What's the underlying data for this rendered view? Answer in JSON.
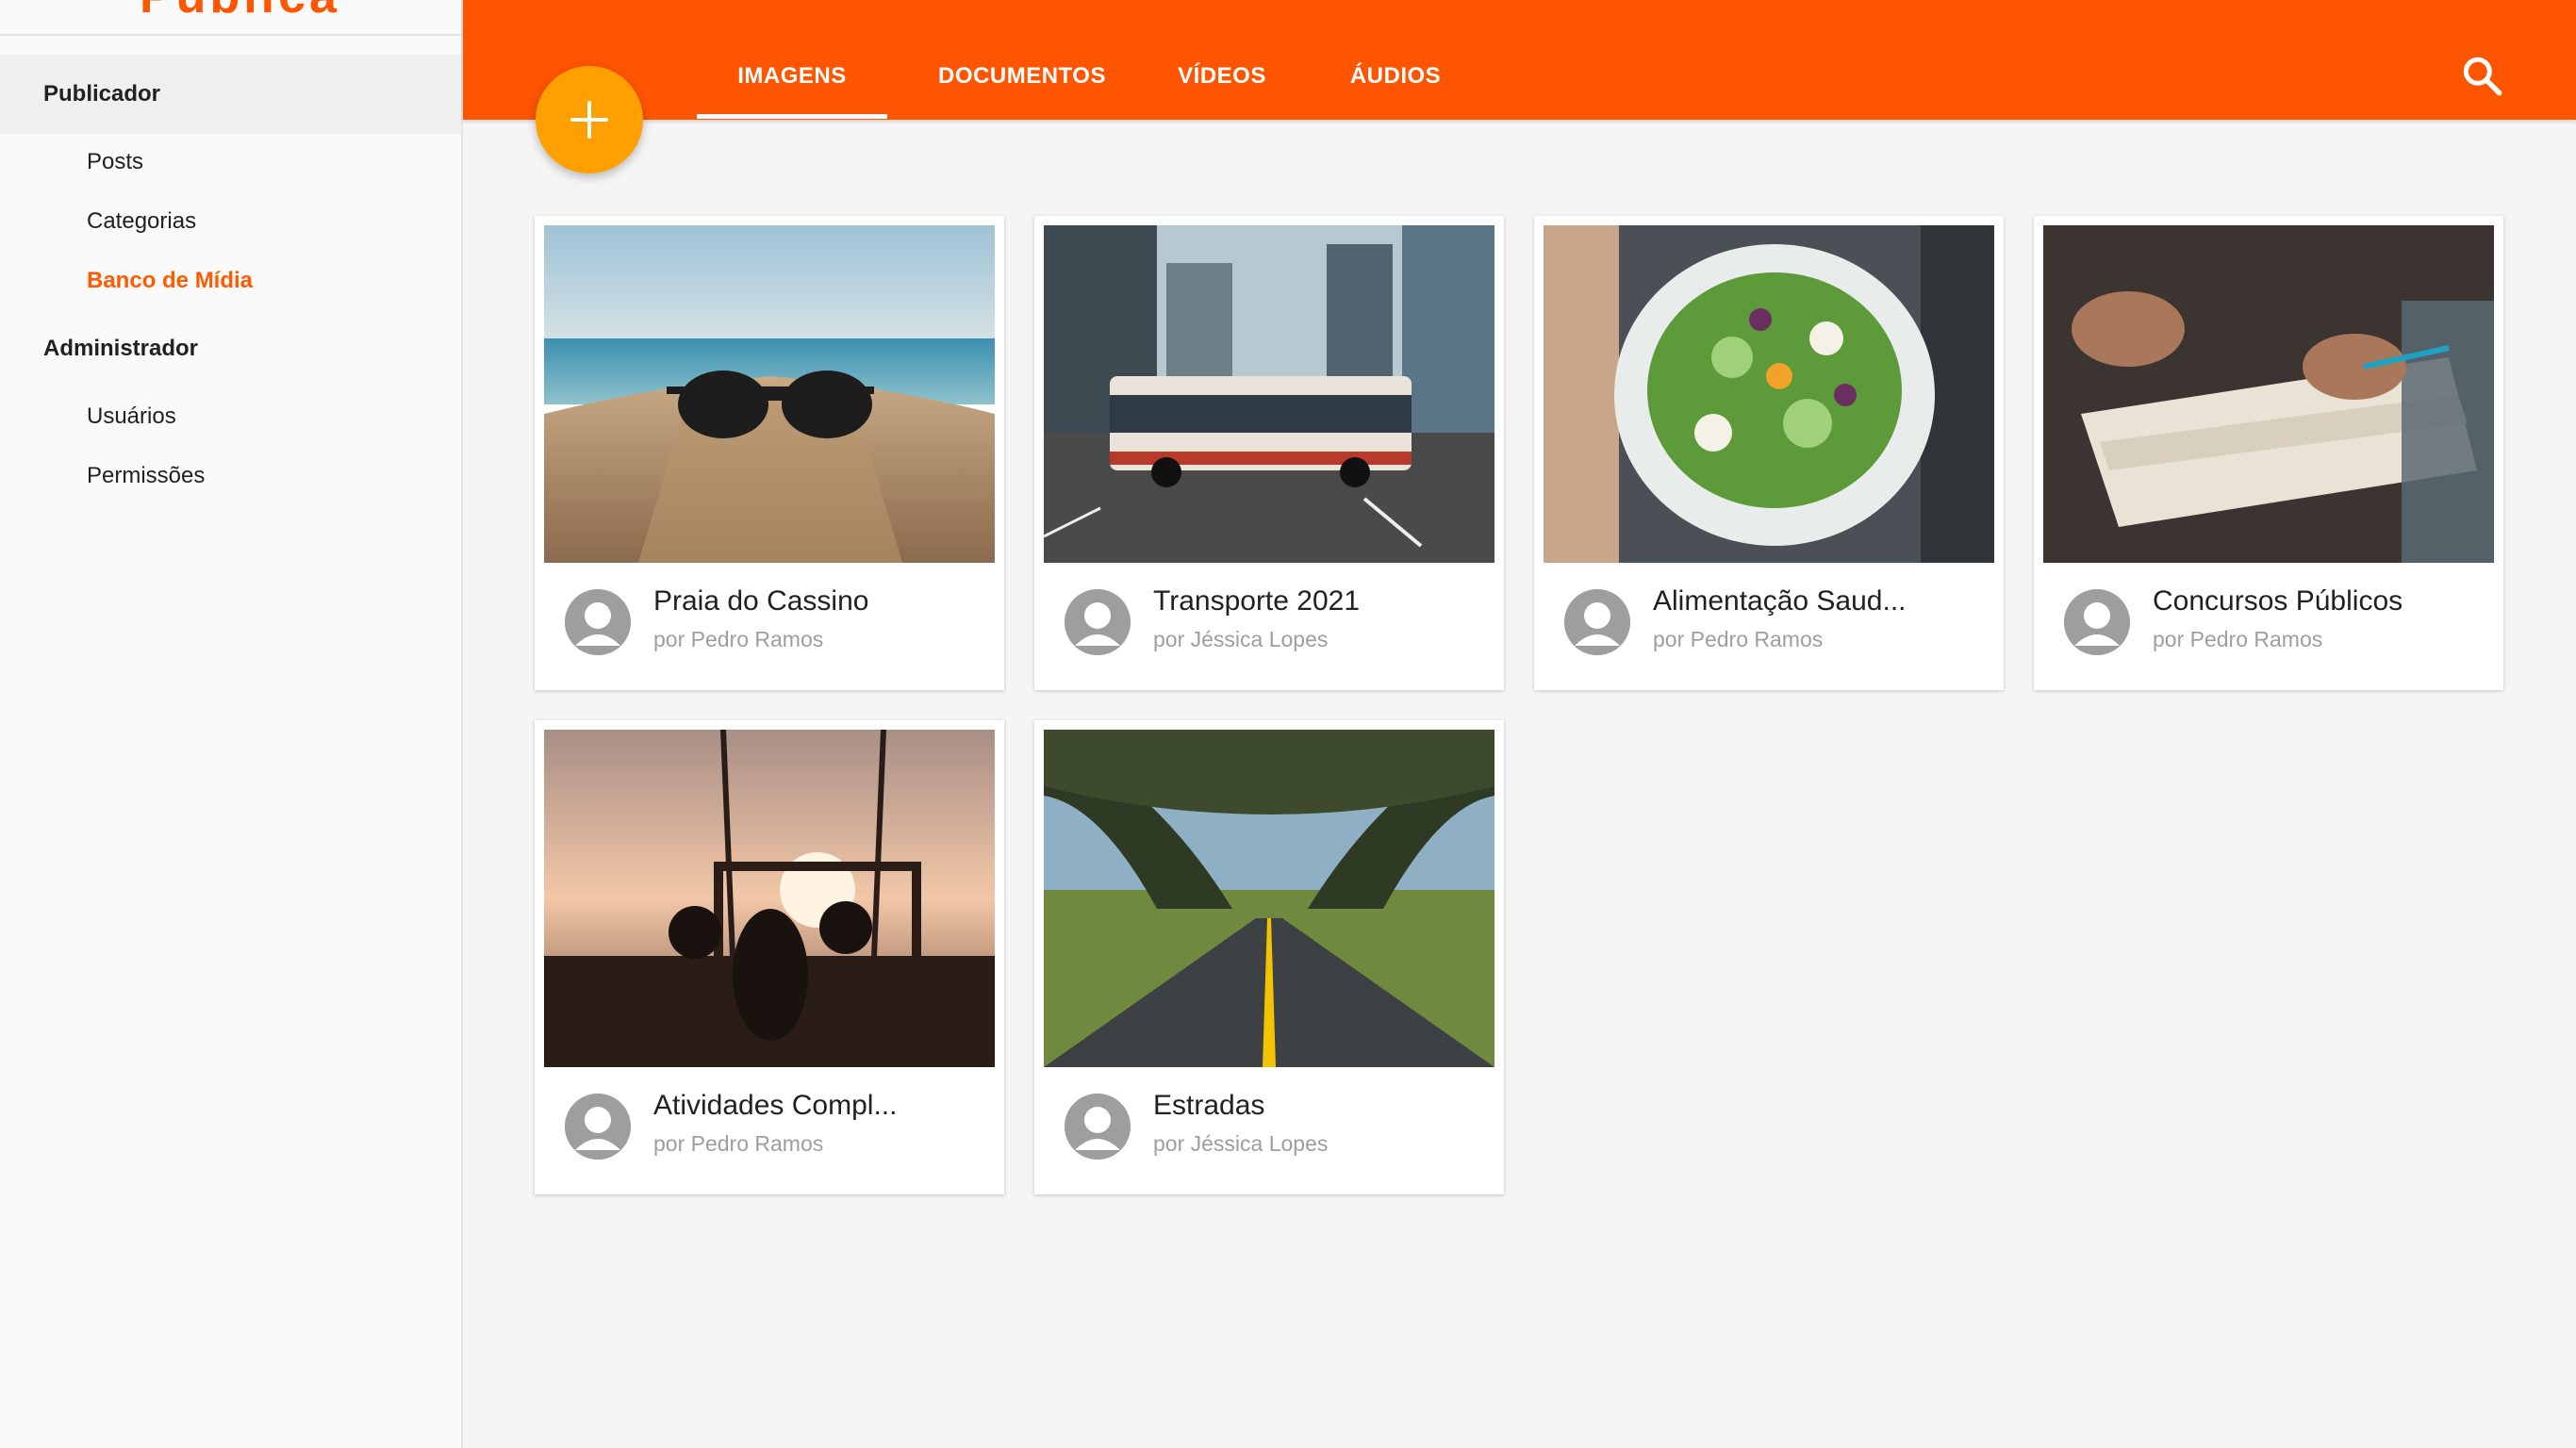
{
  "brand": {
    "name": "Pública"
  },
  "sidebar": {
    "sections": [
      {
        "label": "Publicador",
        "items": [
          {
            "label": "Posts"
          },
          {
            "label": "Categorias"
          },
          {
            "label": "Banco de Mídia"
          }
        ]
      },
      {
        "label": "Administrador",
        "items": [
          {
            "label": "Usuários"
          },
          {
            "label": "Permissões"
          }
        ]
      }
    ],
    "active_item": "Banco de Mídia"
  },
  "tabs": [
    {
      "label": "IMAGENS"
    },
    {
      "label": "DOCUMENTOS"
    },
    {
      "label": "VÍDEOS"
    },
    {
      "label": "ÁUDIOS"
    }
  ],
  "active_tab": "IMAGENS",
  "icons": {
    "search": "search-icon",
    "add": "plus-icon",
    "avatar": "person-icon"
  },
  "colors": {
    "primary": "#ff5500",
    "fab": "#ffa000",
    "active_nav": "#ff5a00"
  },
  "cards": [
    {
      "title": "Praia do Cassino",
      "author": "por Pedro Ramos",
      "image": "sunglasses on beach sand"
    },
    {
      "title": "Transporte 2021",
      "author": "por Jéssica Lopes",
      "image": "city bus on street"
    },
    {
      "title": "Alimentação Saud...",
      "author": "por Pedro Ramos",
      "image": "salad bowl"
    },
    {
      "title": "Concursos Públicos",
      "author": "por Pedro Ramos",
      "image": "person writing in notebook"
    },
    {
      "title": "Atividades Compl...",
      "author": "por Pedro Ramos",
      "image": "outdoor gym at sunset"
    },
    {
      "title": "Estradas",
      "author": "por Jéssica Lopes",
      "image": "tree-lined road"
    }
  ]
}
